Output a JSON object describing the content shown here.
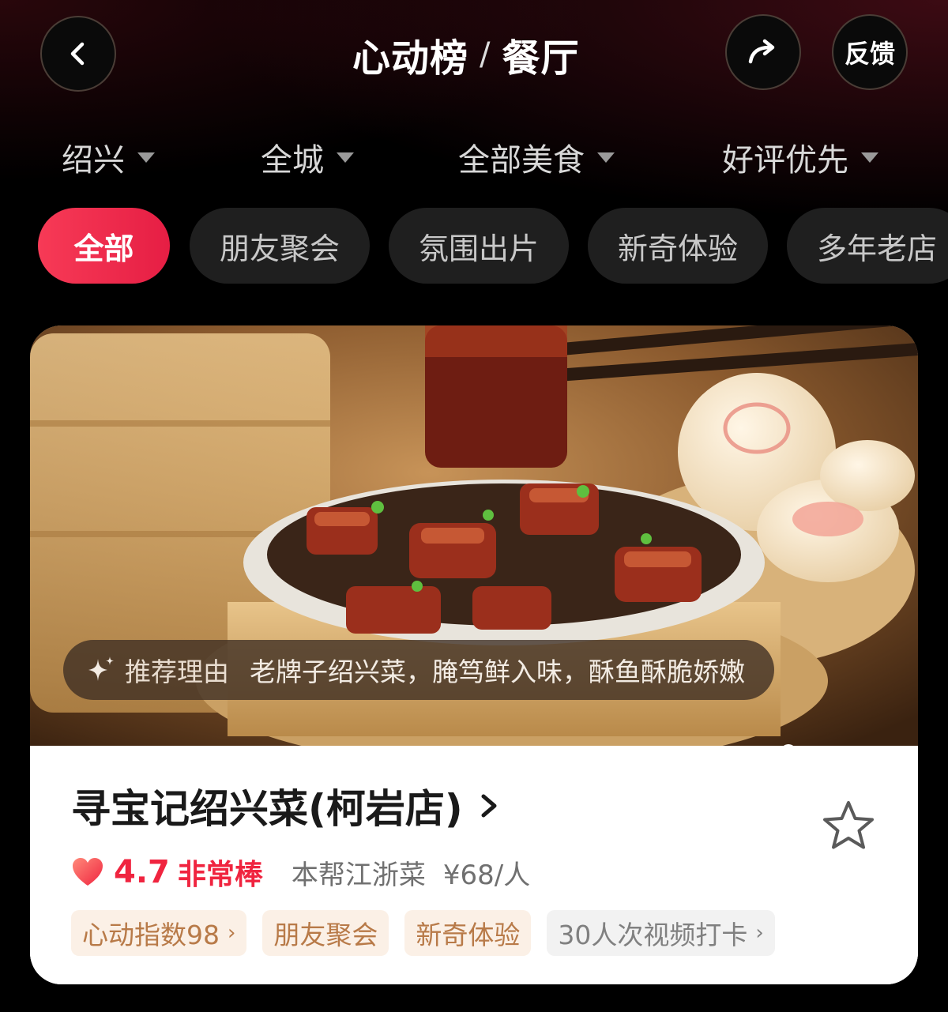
{
  "header": {
    "title_brand": "心动榜",
    "title_separator": "/",
    "title_category": "餐厅",
    "feedback_label": "反馈"
  },
  "filters": [
    {
      "label": "绍兴"
    },
    {
      "label": "全城"
    },
    {
      "label": "全部美食"
    },
    {
      "label": "好评优先"
    }
  ],
  "chips": [
    {
      "label": "全部",
      "active": true
    },
    {
      "label": "朋友聚会",
      "active": false
    },
    {
      "label": "氛围出片",
      "active": false
    },
    {
      "label": "新奇体验",
      "active": false
    },
    {
      "label": "多年老店",
      "active": false
    }
  ],
  "card": {
    "reason_label": "推荐理由",
    "reason_text": "老牌子绍兴菜，腌笃鲜入味，酥鱼酥脆娇嫩",
    "name": "寻宝记绍兴菜(柯岩店)",
    "score": "4.7",
    "score_label": "非常棒",
    "cuisine": "本帮江浙菜",
    "price": "¥68/人",
    "tags": [
      {
        "label": "心动指数98",
        "chevron": "›"
      },
      {
        "label": "朋友聚会"
      },
      {
        "label": "新奇体验"
      },
      {
        "label": "30人次视频打卡",
        "chevron": "›"
      }
    ]
  },
  "colors": {
    "accent": "#f0243f",
    "chip_active": "#f73a56",
    "tag_warm_text": "#b87a48",
    "tag_warm_bg": "#fbf0e6"
  }
}
